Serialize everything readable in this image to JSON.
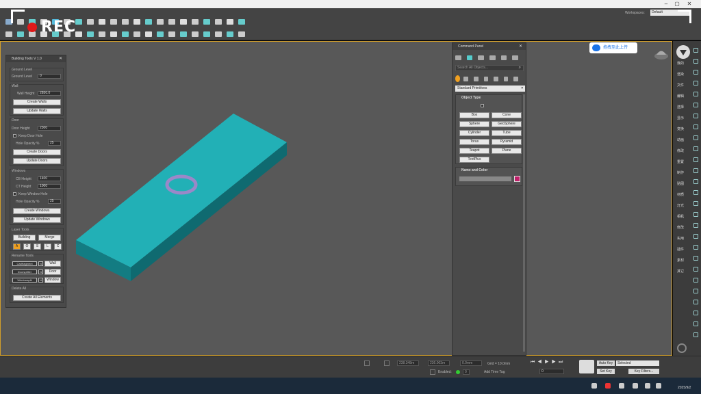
{
  "title_bar": {
    "minimize": "–",
    "maximize": "▢",
    "close": "✕"
  },
  "workspaces": {
    "label": "Workspaces:",
    "value": "Default"
  },
  "recording": {
    "label": "REC"
  },
  "upload_button": {
    "label": "拖拽至此上传"
  },
  "building_tools": {
    "title": "Building Tools V 1.0",
    "close": "✕",
    "ground_level": {
      "group": "Ground Level",
      "label": "Ground Level",
      "value": "0"
    },
    "wall": {
      "group": "Wall",
      "height_label": "Wall Height",
      "height_value": "2850.0",
      "create": "Create Walls",
      "update": "Update Walls"
    },
    "door": {
      "group": "Door",
      "height_label": "Door Height",
      "height_value": "2300",
      "keep_hole": "Keep Door Hole",
      "opacity_label": "Hole Opacity %",
      "opacity_value": "25",
      "create": "Create Doors",
      "update": "Update Doors"
    },
    "windows": {
      "group": "Windows",
      "cb_label": "CB Height",
      "cb_value": "1400",
      "ct_label": "CT Height",
      "ct_value": "1000",
      "keep_hole": "Keep Window Hole",
      "opacity_label": "Hole Opacity %",
      "opacity_value": "25",
      "create": "Create Windows",
      "update": "Update Windows"
    },
    "layer_tools": {
      "group": "Layer Tools",
      "building": "Building",
      "merge": "Merge",
      "letters": [
        "A",
        "O",
        "S",
        "L",
        "C"
      ]
    },
    "rename_tools": {
      "group": "Rename Tools",
      "rows": [
        {
          "name": "Cadfragment",
          "n": "N",
          "action": "Wall"
        },
        {
          "name": "Doorsplitter",
          "n": "N",
          "action": "Door"
        },
        {
          "name": "Windowsplit",
          "n": "N",
          "action": "Window"
        }
      ]
    },
    "delete_all": {
      "group": "Delete All",
      "button": "Create All Elements"
    }
  },
  "command_panel": {
    "title": "Command Panel",
    "close": "✕",
    "search_placeholder": "Search All Objects...",
    "dropdown": "Standard Primitives",
    "object_type": {
      "title": "Object Type",
      "buttons": [
        "Box",
        "Cone",
        "Sphere",
        "GeoSphere",
        "Cylinder",
        "Tube",
        "Torus",
        "Pyramid",
        "Teapot",
        "Plane",
        "TextPlus"
      ]
    },
    "name_color": {
      "title": "Name and Color"
    },
    "object_color": "#c0206a"
  },
  "sidebar": {
    "items": [
      "我的",
      "渲染",
      "文件",
      "编辑",
      "选择",
      "显示",
      "变换",
      "动画",
      "修改",
      "重置",
      "制作",
      "贴图",
      "材质",
      "灯光",
      "相机",
      "修改",
      "实用",
      "插件",
      "素材",
      "其它"
    ]
  },
  "bottom_bar": {
    "coords": [
      "238.348m",
      "236.003m",
      "0.0mm"
    ],
    "grid": "Grid = 10.0mm",
    "time_field": "0",
    "autokey": "Auto Key",
    "setkey": "Set Key",
    "selected": "Selected",
    "key_filters": "Key Filters...",
    "enabled_label": "Enabled:",
    "enabled_value": "0",
    "add_time_tag": "Add Time Tag"
  },
  "taskbar": {
    "date": "2025/9/2"
  },
  "colors": {
    "slab": "#1c9aa0",
    "torus": "#9a88c8",
    "accent": "#d4a02a"
  }
}
